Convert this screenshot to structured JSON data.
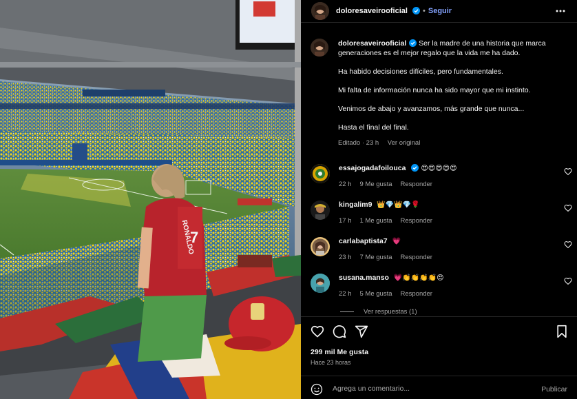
{
  "post_author": {
    "username": "doloresaveirooficial",
    "follow_label": "Seguir",
    "separator": "•"
  },
  "caption": {
    "lines": [
      "Ser la madre de una historia que marca generaciones es el mejor regalo que la vida me ha dado.",
      "Ha habido decisiones difíciles, pero fundamentales.",
      "Mi falta de información nunca ha sido mayor que mi instinto.",
      "Venimos de abajo y avanzamos, más grande que nunca...",
      "Hasta el final del final."
    ],
    "edited_label": "Editado · 23 h",
    "translate_label": "Ver original"
  },
  "comments": [
    {
      "username": "essajogadafoilouca",
      "text": "😍😍😍😍😍",
      "time": "22 h",
      "likes": "9 Me gusta",
      "reply_label": "Responder",
      "avatar_color": "#d9a400"
    },
    {
      "username": "kingalim9",
      "text": "👑💎👑💎🌹",
      "time": "17 h",
      "likes": "1 Me gusta",
      "reply_label": "Responder",
      "avatar_color": "#1a1a1a"
    },
    {
      "username": "carlabaptista7",
      "text": "💗",
      "time": "23 h",
      "likes": "7 Me gusta",
      "reply_label": "Responder",
      "avatar_color": "#7b5f46"
    },
    {
      "username": "susana.manso",
      "text": "💗👏👏👏👏😍",
      "time": "22 h",
      "likes": "5 Me gusta",
      "reply_label": "Responder",
      "avatar_color": "#3a8e9a"
    }
  ],
  "view_replies": "Ver respuestas (1)",
  "engagement": {
    "likes": "299 mil Me gusta",
    "time_ago": "Hace 23 horas"
  },
  "composer": {
    "placeholder": "Agrega un comentario...",
    "publish_label": "Publicar"
  },
  "photo": {
    "jersey_text": "RONALDO",
    "jersey_number": "7"
  },
  "colors": {
    "verified": "#0095f6",
    "follow": "#85a3ff",
    "muted": "#a8a8a8",
    "heart": "#ff3040"
  },
  "icons": [
    "more-icon",
    "heart-outline-icon",
    "comment-icon",
    "share-icon",
    "bookmark-icon",
    "emoji-icon",
    "verified-badge-icon"
  ]
}
